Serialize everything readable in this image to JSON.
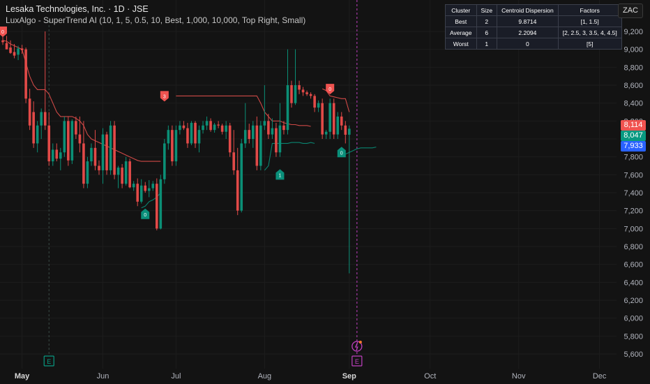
{
  "header": {
    "title": "Lesaka Technologies, Inc. · 1D · JSE",
    "indicator": "LuxAlgo - SuperTrend AI (10, 1, 5, 0.5, 10, Best, 1,000, 10,000, Top Right, Small)"
  },
  "currency_button": "ZAC",
  "cluster_table": {
    "headers": [
      "Cluster",
      "Size",
      "Centroid Dispersion",
      "Factors"
    ],
    "rows": [
      [
        "Best",
        "2",
        "9.8714",
        "[1, 1.5]"
      ],
      [
        "Average",
        "6",
        "2.2094",
        "[2, 2.5, 3, 3.5, 4, 4.5]"
      ],
      [
        "Worst",
        "1",
        "0",
        "[5]"
      ]
    ]
  },
  "price_tags": [
    {
      "label": "8,114",
      "value": 8114,
      "color": "#f05350"
    },
    {
      "label": "8,047",
      "value": 8047,
      "color": "#089981"
    },
    {
      "label": "7,933",
      "value": 7933,
      "color": "#2962ff"
    }
  ],
  "colors": {
    "bull": "#089981",
    "bear": "#f05350",
    "background": "#131313",
    "grid": "#1d1d1d",
    "axis_text": "#b2b5be",
    "event": "#c040c0"
  },
  "chart_data": {
    "type": "candlestick",
    "title": "Lesaka Technologies, Inc. · 1D · JSE",
    "y_axis": {
      "min": 5500,
      "max": 9300,
      "position": "right",
      "ticks": [
        5600,
        5800,
        6000,
        6200,
        6400,
        6600,
        6800,
        7000,
        7200,
        7400,
        7600,
        7800,
        8000,
        8200,
        8400,
        8600,
        8800,
        9000,
        9200
      ],
      "tick_labels": [
        "5,600",
        "5,800",
        "6,000",
        "6,200",
        "6,400",
        "6,600",
        "6,800",
        "7,000",
        "7,200",
        "7,400",
        "7,600",
        "7,800",
        "8,000",
        "8,200",
        "8,400",
        "8,600",
        "8,800",
        "9,000",
        "9,200"
      ]
    },
    "x_axis": {
      "labels": [
        {
          "label": "May",
          "index": 5,
          "bold": true
        },
        {
          "label": "Jun",
          "index": 26,
          "bold": false
        },
        {
          "label": "Jul",
          "index": 45,
          "bold": false
        },
        {
          "label": "Aug",
          "index": 68,
          "bold": false
        },
        {
          "label": "Sep",
          "index": 90,
          "bold": true
        },
        {
          "label": "Oct",
          "index": 111,
          "bold": false
        },
        {
          "label": "Nov",
          "index": 134,
          "bold": false
        },
        {
          "label": "Dec",
          "index": 155,
          "bold": false
        }
      ]
    },
    "grid": true,
    "candles": [
      {
        "o": 9100,
        "h": 9200,
        "l": 9050,
        "c": 9080
      },
      {
        "o": 9070,
        "h": 9150,
        "l": 9000,
        "c": 9000
      },
      {
        "o": 9020,
        "h": 9100,
        "l": 8950,
        "c": 8960
      },
      {
        "o": 8970,
        "h": 9060,
        "l": 8900,
        "c": 8930
      },
      {
        "o": 8940,
        "h": 9040,
        "l": 8880,
        "c": 9010
      },
      {
        "o": 9010,
        "h": 9050,
        "l": 8950,
        "c": 8990
      },
      {
        "o": 9000,
        "h": 9020,
        "l": 8400,
        "c": 8450
      },
      {
        "o": 8450,
        "h": 8560,
        "l": 8100,
        "c": 8150
      },
      {
        "o": 8300,
        "h": 8420,
        "l": 7900,
        "c": 7950
      },
      {
        "o": 7950,
        "h": 8200,
        "l": 7850,
        "c": 8150
      },
      {
        "o": 8150,
        "h": 8340,
        "l": 8000,
        "c": 8300
      },
      {
        "o": 8300,
        "h": 9200,
        "l": 8100,
        "c": 8150
      },
      {
        "o": 8150,
        "h": 8300,
        "l": 7700,
        "c": 7750
      },
      {
        "o": 7750,
        "h": 7950,
        "l": 7700,
        "c": 7880
      },
      {
        "o": 7880,
        "h": 7950,
        "l": 7750,
        "c": 7780
      },
      {
        "o": 7780,
        "h": 7900,
        "l": 7650,
        "c": 7850
      },
      {
        "o": 7850,
        "h": 8250,
        "l": 7800,
        "c": 8200
      },
      {
        "o": 8200,
        "h": 8250,
        "l": 7700,
        "c": 7760
      },
      {
        "o": 7760,
        "h": 8220,
        "l": 7720,
        "c": 8200
      },
      {
        "o": 8200,
        "h": 8250,
        "l": 8000,
        "c": 8050
      },
      {
        "o": 8050,
        "h": 8250,
        "l": 7850,
        "c": 7950
      },
      {
        "o": 7950,
        "h": 8200,
        "l": 7450,
        "c": 7500
      },
      {
        "o": 7500,
        "h": 7800,
        "l": 7450,
        "c": 7750
      },
      {
        "o": 7750,
        "h": 7950,
        "l": 7700,
        "c": 7900
      },
      {
        "o": 7900,
        "h": 8100,
        "l": 7650,
        "c": 7700
      },
      {
        "o": 7700,
        "h": 7760,
        "l": 7600,
        "c": 7650
      },
      {
        "o": 7650,
        "h": 8120,
        "l": 7500,
        "c": 8050
      },
      {
        "o": 8050,
        "h": 8080,
        "l": 7600,
        "c": 7650
      },
      {
        "o": 7650,
        "h": 8200,
        "l": 7600,
        "c": 8150
      },
      {
        "o": 8150,
        "h": 8200,
        "l": 7550,
        "c": 7600
      },
      {
        "o": 7600,
        "h": 7700,
        "l": 7450,
        "c": 7680
      },
      {
        "o": 7680,
        "h": 7720,
        "l": 7450,
        "c": 7500
      },
      {
        "o": 7500,
        "h": 7800,
        "l": 7480,
        "c": 7750
      },
      {
        "o": 7750,
        "h": 7780,
        "l": 7450,
        "c": 7460
      },
      {
        "o": 7460,
        "h": 7530,
        "l": 7420,
        "c": 7500
      },
      {
        "o": 7500,
        "h": 7560,
        "l": 7250,
        "c": 7300
      },
      {
        "o": 7300,
        "h": 7550,
        "l": 7280,
        "c": 7480
      },
      {
        "o": 7480,
        "h": 7520,
        "l": 7400,
        "c": 7420
      },
      {
        "o": 7420,
        "h": 7540,
        "l": 7350,
        "c": 7450
      },
      {
        "o": 7450,
        "h": 7530,
        "l": 7420,
        "c": 7500
      },
      {
        "o": 7500,
        "h": 7560,
        "l": 6980,
        "c": 7000
      },
      {
        "o": 7000,
        "h": 7600,
        "l": 6990,
        "c": 7550
      },
      {
        "o": 7550,
        "h": 8000,
        "l": 7500,
        "c": 7950
      },
      {
        "o": 7950,
        "h": 8150,
        "l": 7880,
        "c": 8100
      },
      {
        "o": 8100,
        "h": 8150,
        "l": 7700,
        "c": 7750
      },
      {
        "o": 7750,
        "h": 8150,
        "l": 7700,
        "c": 8100
      },
      {
        "o": 8100,
        "h": 8200,
        "l": 8050,
        "c": 8150
      },
      {
        "o": 8150,
        "h": 8200,
        "l": 8100,
        "c": 8120
      },
      {
        "o": 8120,
        "h": 8180,
        "l": 7900,
        "c": 7950
      },
      {
        "o": 7950,
        "h": 8200,
        "l": 7930,
        "c": 8180
      },
      {
        "o": 8180,
        "h": 8200,
        "l": 7900,
        "c": 7950
      },
      {
        "o": 7950,
        "h": 8150,
        "l": 7850,
        "c": 8100
      },
      {
        "o": 8100,
        "h": 8200,
        "l": 8060,
        "c": 8150
      },
      {
        "o": 8150,
        "h": 8250,
        "l": 8100,
        "c": 8200
      },
      {
        "o": 8200,
        "h": 8230,
        "l": 8080,
        "c": 8100
      },
      {
        "o": 8100,
        "h": 8180,
        "l": 8070,
        "c": 8160
      },
      {
        "o": 8160,
        "h": 8200,
        "l": 8120,
        "c": 8150
      },
      {
        "o": 8150,
        "h": 8170,
        "l": 8050,
        "c": 8080
      },
      {
        "o": 8080,
        "h": 8200,
        "l": 8000,
        "c": 8150
      },
      {
        "o": 8150,
        "h": 8180,
        "l": 7800,
        "c": 7850
      },
      {
        "o": 7850,
        "h": 8100,
        "l": 7600,
        "c": 7650
      },
      {
        "o": 7650,
        "h": 7900,
        "l": 7150,
        "c": 7200
      },
      {
        "o": 7200,
        "h": 8000,
        "l": 7180,
        "c": 7950
      },
      {
        "o": 7950,
        "h": 8400,
        "l": 7900,
        "c": 8100
      },
      {
        "o": 8100,
        "h": 8170,
        "l": 7950,
        "c": 8000
      },
      {
        "o": 8000,
        "h": 8200,
        "l": 7900,
        "c": 8150
      },
      {
        "o": 8150,
        "h": 8250,
        "l": 7650,
        "c": 7700
      },
      {
        "o": 7700,
        "h": 8200,
        "l": 7650,
        "c": 8150
      },
      {
        "o": 8150,
        "h": 8600,
        "l": 8100,
        "c": 8200
      },
      {
        "o": 8200,
        "h": 8280,
        "l": 8000,
        "c": 8050
      },
      {
        "o": 8050,
        "h": 8230,
        "l": 8000,
        "c": 8120
      },
      {
        "o": 8120,
        "h": 8180,
        "l": 7800,
        "c": 7850
      },
      {
        "o": 7850,
        "h": 8400,
        "l": 7800,
        "c": 8150
      },
      {
        "o": 8150,
        "h": 8200,
        "l": 8050,
        "c": 8100
      },
      {
        "o": 8100,
        "h": 9000,
        "l": 8050,
        "c": 8600
      },
      {
        "o": 8600,
        "h": 8650,
        "l": 8350,
        "c": 8400
      },
      {
        "o": 8400,
        "h": 9000,
        "l": 8380,
        "c": 8600
      },
      {
        "o": 8600,
        "h": 8650,
        "l": 8500,
        "c": 8550
      },
      {
        "o": 8550,
        "h": 8580,
        "l": 8480,
        "c": 8520
      },
      {
        "o": 8520,
        "h": 8540,
        "l": 8480,
        "c": 8500
      },
      {
        "o": 8500,
        "h": 8520,
        "l": 8450,
        "c": 8480
      },
      {
        "o": 8480,
        "h": 8500,
        "l": 8300,
        "c": 8350
      },
      {
        "o": 8350,
        "h": 8430,
        "l": 8300,
        "c": 8400
      },
      {
        "o": 8400,
        "h": 8450,
        "l": 8000,
        "c": 8050
      },
      {
        "o": 8050,
        "h": 8100,
        "l": 8000,
        "c": 8080
      },
      {
        "o": 8080,
        "h": 8450,
        "l": 8000,
        "c": 8400
      },
      {
        "o": 8400,
        "h": 8450,
        "l": 8000,
        "c": 8050
      },
      {
        "o": 8050,
        "h": 8300,
        "l": 8000,
        "c": 8250
      },
      {
        "o": 8250,
        "h": 8300,
        "l": 8100,
        "c": 8150
      },
      {
        "o": 8150,
        "h": 8200,
        "l": 7950,
        "c": 8047
      },
      {
        "o": 8047,
        "h": 8150,
        "l": 6500,
        "c": 8114
      }
    ],
    "supertrend": {
      "bear_segments": [
        [
          9100,
          9090,
          9060,
          9040,
          9020,
          9000,
          8850,
          8700,
          8600,
          8550,
          8550,
          8550,
          8500,
          8400,
          8300,
          8250,
          8250,
          8250,
          8250,
          8230,
          8200,
          8150,
          8050,
          8000,
          7980,
          7960,
          7940,
          7920,
          7900,
          7880,
          7860,
          7840,
          7820,
          7800,
          7780,
          7760,
          7750,
          7750,
          7750,
          7750,
          7750,
          7750
        ],
        [
          8480,
          8480,
          8480,
          8480,
          8480,
          8480,
          8480,
          8480,
          8480,
          8480,
          8480,
          8480,
          8480,
          8480,
          8480,
          8480,
          8480,
          8480,
          8480,
          8480,
          8480,
          8480,
          8400,
          8300,
          8250,
          8200,
          8200,
          8200,
          8180,
          8170,
          8160,
          8160,
          8150,
          8150,
          8150,
          8140
        ],
        [
          8560,
          8540,
          8480,
          8470,
          8460,
          8450,
          8450,
          8300
        ]
      ],
      "bear_start_indices": [
        0,
        45,
        83
      ],
      "bull_segments": [
        [
          7230,
          7250,
          7300,
          7320,
          7350,
          7400
        ],
        [
          7650,
          7700,
          7950,
          7950,
          7950,
          7950,
          7950,
          7960,
          7960,
          7960,
          7950,
          7950,
          7960,
          7950
        ],
        [
          7800,
          7830,
          7850,
          7870,
          7890,
          7900,
          7900,
          7900,
          7900,
          7910
        ]
      ],
      "bull_start_indices": [
        36,
        68,
        88
      ],
      "signals": [
        {
          "label": "0",
          "index": 0,
          "value": 9200,
          "type": "bear"
        },
        {
          "label": "3",
          "index": 42,
          "value": 8480,
          "type": "bear"
        },
        {
          "label": "0",
          "index": 37,
          "value": 7160,
          "type": "bull"
        },
        {
          "label": "1",
          "index": 72,
          "value": 7600,
          "type": "bull"
        },
        {
          "label": "0",
          "index": 85,
          "value": 8560,
          "type": "bear"
        },
        {
          "label": "0",
          "index": 88,
          "value": 7850,
          "type": "bull"
        }
      ]
    },
    "events": [
      {
        "label": "E",
        "index": 12,
        "type": "earnings-past"
      },
      {
        "label": "E",
        "index": 92,
        "type": "earnings-upcoming"
      }
    ]
  }
}
